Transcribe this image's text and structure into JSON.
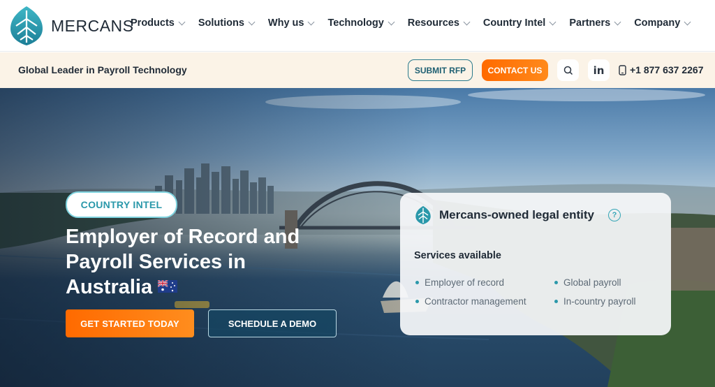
{
  "brand": {
    "name": "MERCANS",
    "accent": "#2a98aa",
    "orange": "#ff6a00"
  },
  "nav": {
    "items": [
      {
        "label": "Products"
      },
      {
        "label": "Solutions"
      },
      {
        "label": "Why us"
      },
      {
        "label": "Technology"
      },
      {
        "label": "Resources"
      },
      {
        "label": "Country Intel"
      },
      {
        "label": "Partners"
      },
      {
        "label": "Company"
      }
    ]
  },
  "subbar": {
    "tagline": "Global Leader in Payroll Technology",
    "submit_rfp": "SUBMIT RFP",
    "contact_us": "CONTACT US",
    "search_icon": "search-icon",
    "linkedin_label": "in",
    "phone": "+1 877 637 2267"
  },
  "hero": {
    "pill": "COUNTRY INTEL",
    "title": "Employer of Record and Payroll Services in Australia",
    "flag": "australia-flag-icon",
    "cta_primary": "GET STARTED TODAY",
    "cta_secondary": "SCHEDULE A DEMO"
  },
  "card": {
    "title": "Mercans-owned legal entity",
    "help": "?",
    "services_title": "Services available",
    "services": [
      "Employer of record",
      "Global payroll",
      "Contractor management",
      "In-country payroll"
    ]
  }
}
